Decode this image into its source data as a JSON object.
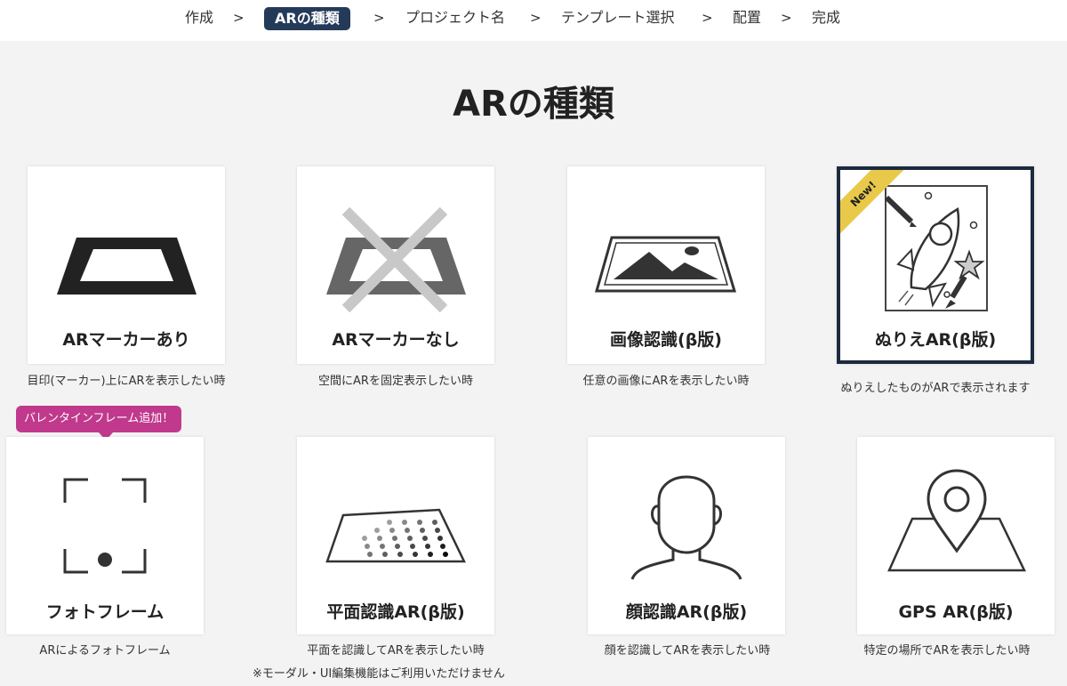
{
  "breadcrumb": {
    "steps": [
      "作成",
      "ARの種類",
      "プロジェクト名",
      "テンプレート選択",
      "配置",
      "完成"
    ],
    "separator": ">",
    "active_index": 1
  },
  "page": {
    "title": "ARの種類"
  },
  "cards": [
    {
      "label": "ARマーカーあり",
      "description": "目印(マーカー)上にARを表示したい時"
    },
    {
      "label": "ARマーカーなし",
      "description": "空間にARを固定表示したい時"
    },
    {
      "label": "画像認識(β版)",
      "description": "任意の画像にARを表示したい時"
    },
    {
      "label": "ぬりえAR(β版)",
      "description": "ぬりえしたものがARで表示されます",
      "badge": "New!",
      "selected": true
    },
    {
      "label": "フォトフレーム",
      "description": "ARによるフォトフレーム",
      "tooltip": "バレンタインフレーム追加！"
    },
    {
      "label": "平面認識AR(β版)",
      "description": "平面を認識してARを表示したい時",
      "note": "※モーダル・UI編集機能はご利用いただけません"
    },
    {
      "label": "顔認識AR(β版)",
      "description": "顔を認識してARを表示したい時"
    },
    {
      "label": "GPS AR(β版)",
      "description": "特定の場所でARを表示したい時"
    }
  ],
  "icons": [
    "marker-frame-icon",
    "no-marker-icon",
    "image-recognition-icon",
    "coloring-rocket-icon",
    "photo-frame-icon",
    "plane-detection-icon",
    "face-icon",
    "map-pin-icon"
  ],
  "colors": {
    "active_crumb": "#243a59",
    "badge": "#e9c94a",
    "tooltip": "#c0398c",
    "selected_border": "#1c2a3f"
  }
}
